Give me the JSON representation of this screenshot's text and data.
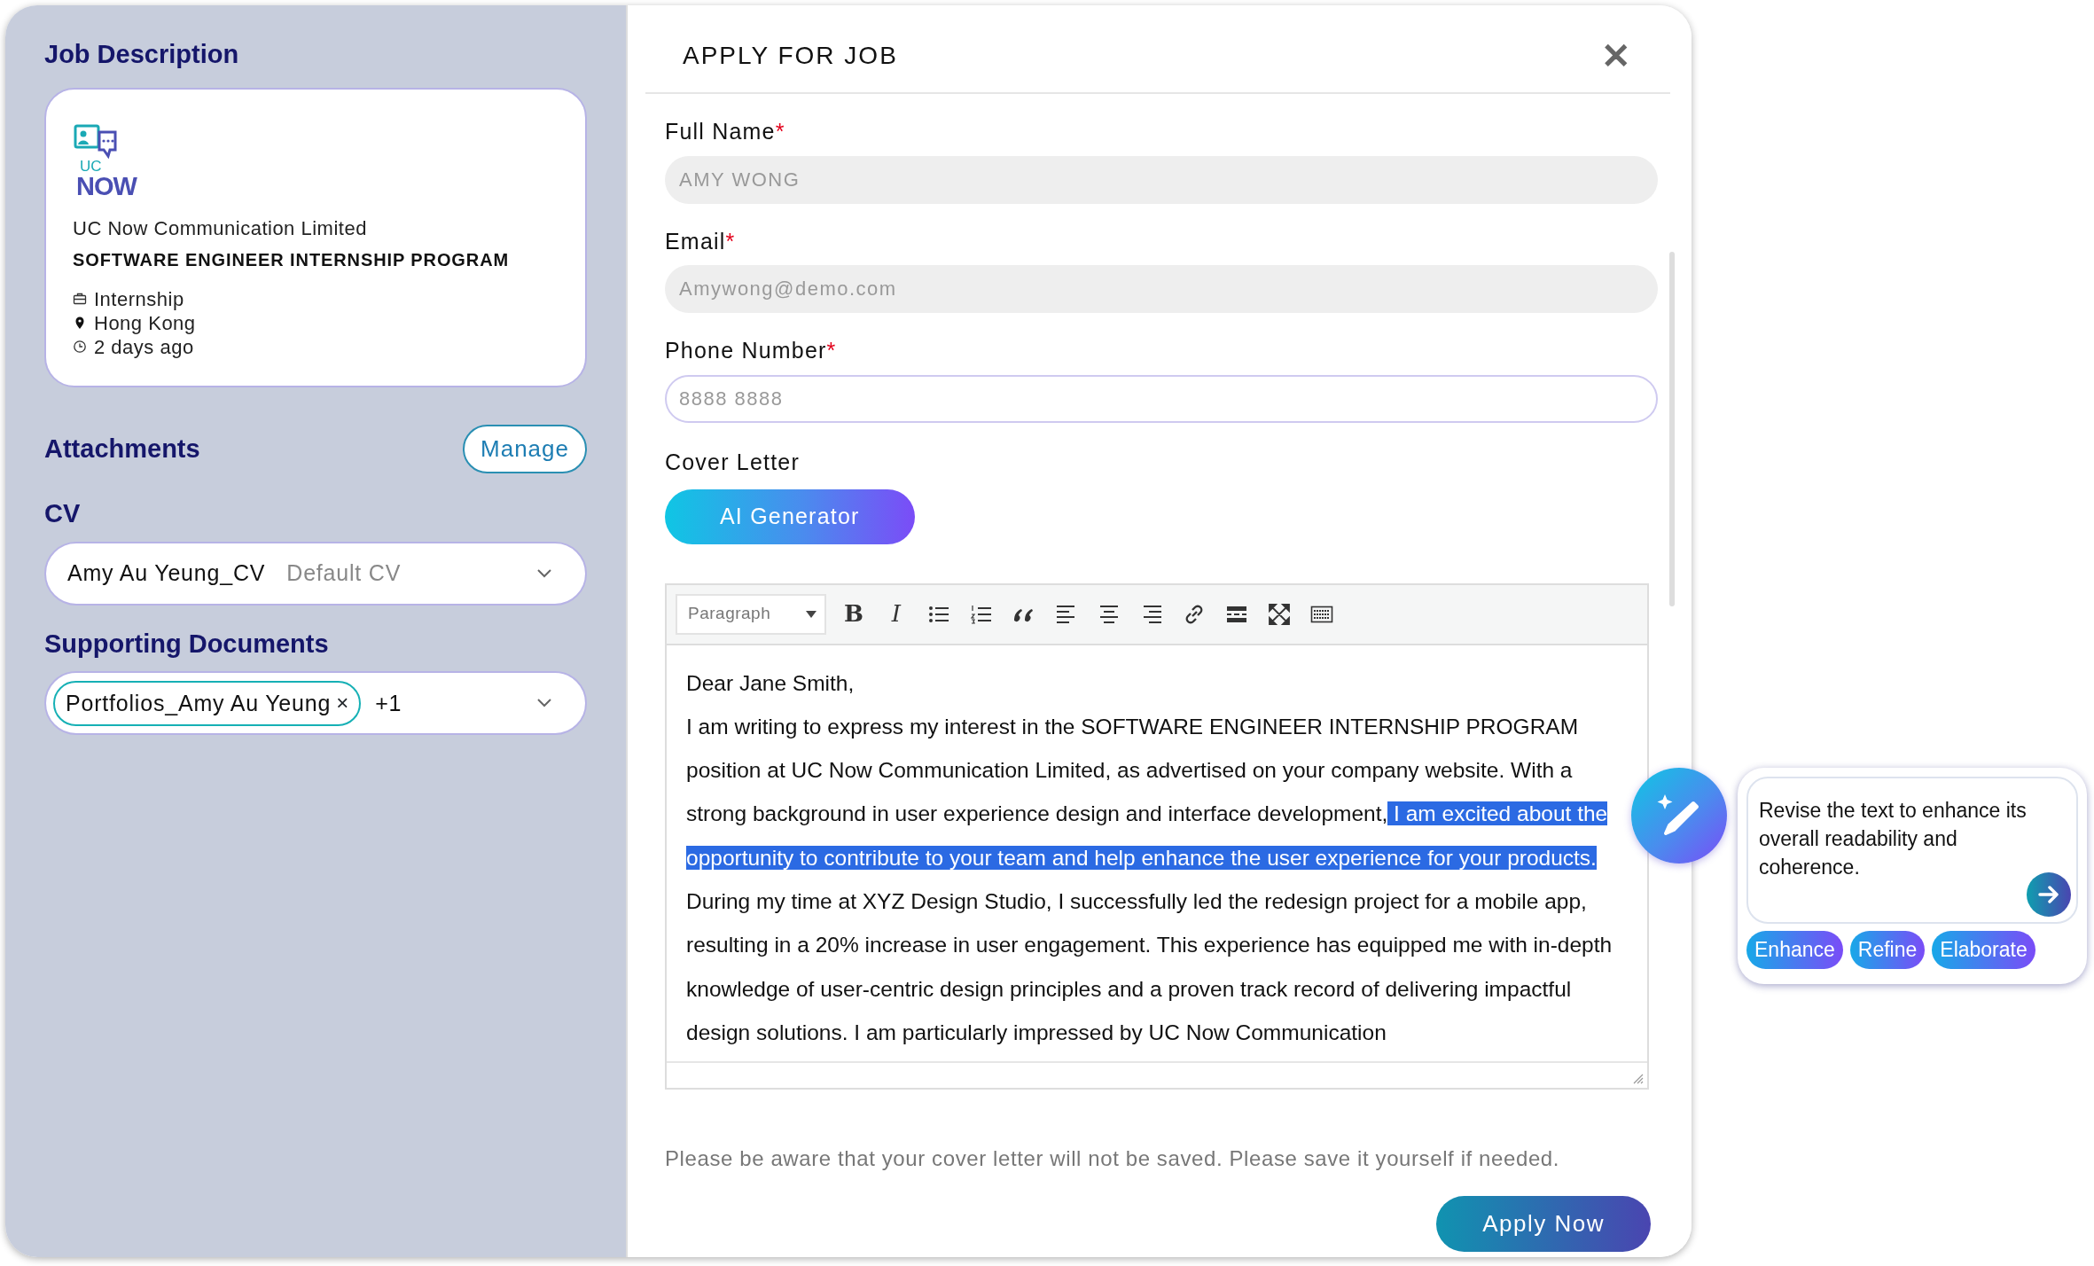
{
  "sidebar": {
    "title": "Job Description",
    "job": {
      "logo": {
        "line1": "UC",
        "line2": "NOW"
      },
      "company": "UC Now Communication Limited",
      "position": "SOFTWARE ENGINEER INTERNSHIP PROGRAM",
      "meta": [
        {
          "kind": "briefcase",
          "text": "Internship"
        },
        {
          "kind": "pin",
          "text": "Hong Kong"
        },
        {
          "kind": "clock",
          "text": "2 days ago"
        }
      ]
    },
    "attachments": {
      "title": "Attachments",
      "button": "Manage"
    },
    "cv": {
      "label": "CV",
      "value": "Amy Au Yeung_CV",
      "note": "Default CV"
    },
    "supporting": {
      "label": "Supporting Documents",
      "tags": [
        {
          "text": "Portfolios_Amy Au Yeung",
          "remove": "×"
        }
      ],
      "more": "+1"
    }
  },
  "modal": {
    "title": "APPLY FOR JOB",
    "close": "✕",
    "fields": [
      {
        "label": "Full Name",
        "required_mark": "*",
        "value": "AMY WONG",
        "disabled": true
      },
      {
        "label": "Email",
        "required_mark": "*",
        "value": "Amywong@demo.com",
        "disabled": true
      },
      {
        "label": "Phone Number",
        "required_mark": "*",
        "placeholder": "8888 8888",
        "disabled": false
      }
    ],
    "cover_letter": {
      "label": "Cover Letter",
      "ai_button": "AI Generator",
      "toolbar": {
        "format": "Paragraph",
        "tools": [
          {
            "kind": "bold",
            "label": "B"
          },
          {
            "kind": "italic",
            "label": "I"
          },
          {
            "kind": "bullets"
          },
          {
            "kind": "numbers"
          },
          {
            "kind": "quote"
          },
          {
            "kind": "align-left"
          },
          {
            "kind": "align-center"
          },
          {
            "kind": "align-right"
          },
          {
            "kind": "link"
          },
          {
            "kind": "hr"
          },
          {
            "kind": "fullscreen"
          },
          {
            "kind": "keyboard"
          }
        ]
      },
      "paragraphs": [
        [
          {
            "text": "Dear Jane Smith,",
            "selected": false
          }
        ],
        [
          {
            "text": "I am writing to express my interest in the SOFTWARE ENGINEER INTERNSHIP PROGRAM position at UC Now Communication Limited, as advertised on your company website. With a strong background in user experience design and interface development,",
            "selected": false
          },
          {
            "text": " I am excited about the opportunity to contribute to your team and help enhance the user experience for your products. ",
            "selected": true
          },
          {
            "text": "During my time at XYZ Design Studio, I successfully led the redesign project for a mobile app, resulting in a 20% increase in user engagement. This experience has equipped me with in-depth knowledge of user-centric design principles and a proven track record of delivering impactful design solutions. I am particularly impressed by UC Now Communication",
            "selected": false
          }
        ]
      ]
    },
    "notice": "Please be aware that your cover letter will not be saved. Please save it yourself if needed.",
    "submit": "Apply Now"
  },
  "ai_assistant": {
    "prompt": "Revise the text to enhance its overall readability and coherence.",
    "actions": [
      "Enhance",
      "Refine",
      "Elaborate"
    ]
  }
}
